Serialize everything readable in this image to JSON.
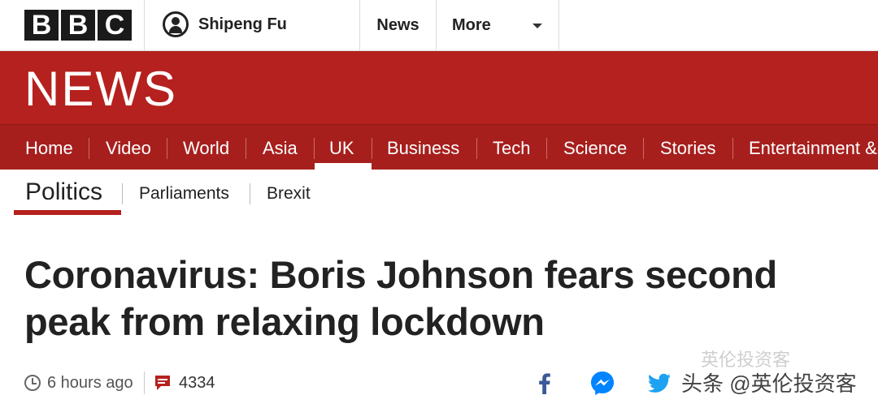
{
  "header": {
    "logo_letters": [
      "B",
      "B",
      "C"
    ],
    "account_name": "Shipeng Fu",
    "news_link": "News",
    "more_link": "More"
  },
  "banner": {
    "wordmark": "NEWS"
  },
  "nav": {
    "items": [
      "Home",
      "Video",
      "World",
      "Asia",
      "UK",
      "Business",
      "Tech",
      "Science",
      "Stories",
      "Entertainment &"
    ],
    "active": "UK"
  },
  "subnav": {
    "current": "Politics",
    "links": [
      "Parliaments",
      "Brexit"
    ]
  },
  "article": {
    "headline_line1": "Coronavirus: Boris Johnson fears second",
    "headline_line2": "peak from relaxing lockdown",
    "timestamp": "6 hours ago",
    "comment_count": "4334"
  },
  "share": {
    "icons": [
      "facebook-icon",
      "messenger-icon",
      "twitter-icon"
    ]
  },
  "watermark": {
    "text": "头条 @英伦投资客",
    "faint_text": "英伦投资客"
  },
  "colors": {
    "bbc_red": "#b5211e",
    "nav_red": "#a71f1d",
    "facebook": "#3b5998",
    "messenger": "#0084ff",
    "twitter": "#1da1f2"
  }
}
